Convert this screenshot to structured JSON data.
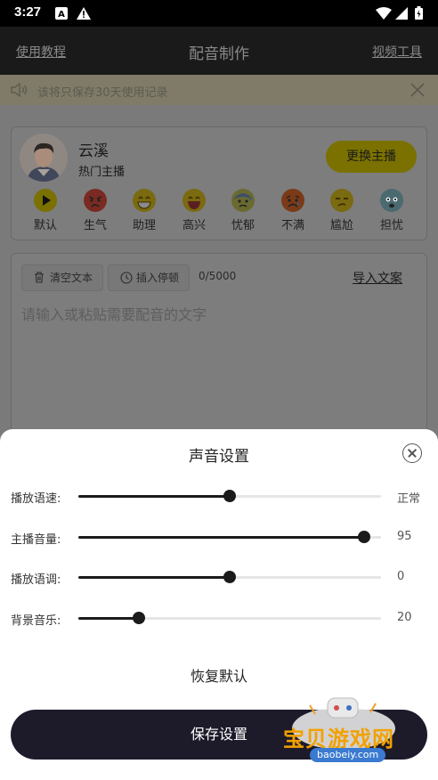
{
  "status_bar": {
    "time": "3:27"
  },
  "nav": {
    "left_link": "使用教程",
    "title": "配音制作",
    "right_link": "视频工具"
  },
  "notice": {
    "text": "该将只保存30天使用记录"
  },
  "anchor": {
    "name": "云溪",
    "subtitle": "热门主播",
    "change_button": "更换主播"
  },
  "emotions": [
    {
      "label": "默认",
      "icon": "play-icon"
    },
    {
      "label": "生气",
      "icon": "angry-face-icon"
    },
    {
      "label": "助理",
      "icon": "grin-face-icon"
    },
    {
      "label": "高兴",
      "icon": "laughing-face-icon"
    },
    {
      "label": "忧郁",
      "icon": "sweat-face-icon"
    },
    {
      "label": "不满",
      "icon": "unhappy-face-icon"
    },
    {
      "label": "尴尬",
      "icon": "unamused-face-icon"
    },
    {
      "label": "担忧",
      "icon": "anxious-face-icon"
    }
  ],
  "editor": {
    "clear_button": "清空文本",
    "pause_button": "插入停顿",
    "counter": "0/5000",
    "import_link": "导入文案",
    "placeholder": "请输入或粘贴需要配音的文字"
  },
  "sheet": {
    "title": "声音设置",
    "sliders": [
      {
        "label": "播放语速:",
        "value_text": "正常",
        "level": 0.5
      },
      {
        "label": "主播音量:",
        "value_text": "95",
        "level": 0.95
      },
      {
        "label": "播放语调:",
        "value_text": "0",
        "level": 0.5
      },
      {
        "label": "背景音乐:",
        "value_text": "20",
        "level": 0.2
      }
    ],
    "restore_button": "恢复默认",
    "save_button": "保存设置"
  },
  "watermark": {
    "text": "宝贝游戏网",
    "url": "baobeiy.com"
  },
  "colors": {
    "accent_yellow": "#f5e000",
    "dark": "#1d1b2a",
    "overlay": "#000000"
  }
}
